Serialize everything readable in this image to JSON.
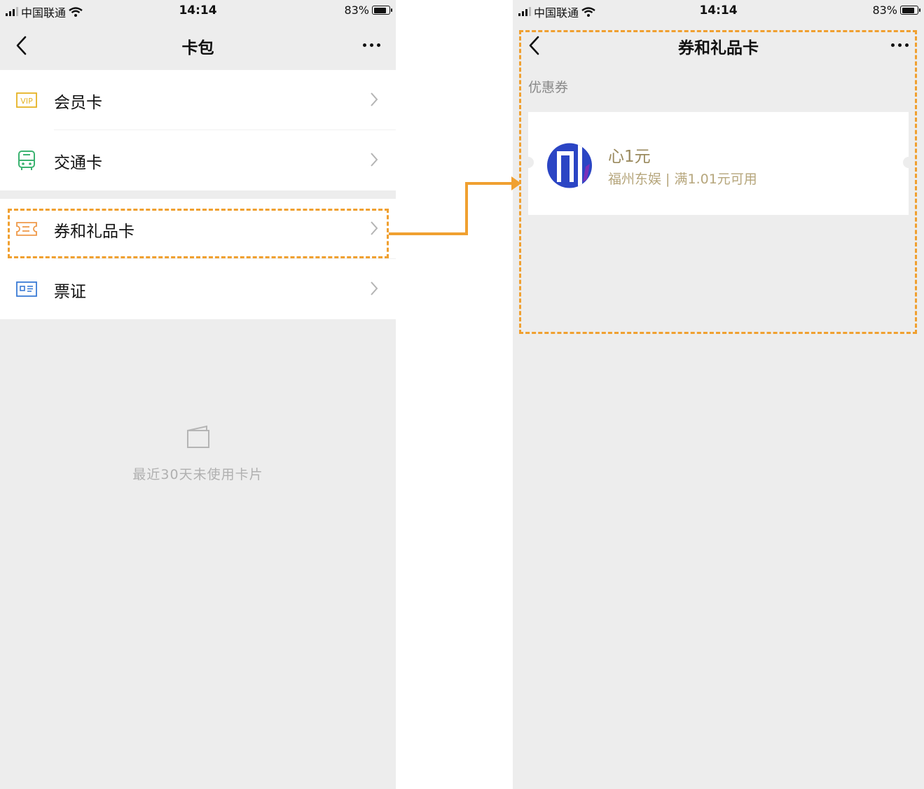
{
  "status_bar": {
    "carrier": "中国联通",
    "time": "14:14",
    "battery": "83%",
    "battery_level": 0.83
  },
  "left_screen": {
    "title": "卡包",
    "menu_groups": [
      [
        {
          "label": "会员卡",
          "icon": "vip-icon"
        },
        {
          "label": "交通卡",
          "icon": "bus-icon"
        }
      ],
      [
        {
          "label": "券和礼品卡",
          "icon": "ticket-icon"
        },
        {
          "label": "票证",
          "icon": "id-card-icon"
        }
      ]
    ],
    "empty_text": "最近30天未使用卡片"
  },
  "right_screen": {
    "title": "券和礼品卡",
    "section_label": "优惠券",
    "coupon": {
      "title": "心1元",
      "subtitle": "福州东娱 | 满1.01元可用"
    }
  },
  "colors": {
    "highlight": "#f0a030",
    "background": "#ededed",
    "vip_icon": "#e5b325",
    "bus_icon": "#3cb371",
    "ticket_icon": "#ef9a4a",
    "id_icon": "#3a7bd5",
    "coupon_title": "#9a8a5e"
  }
}
